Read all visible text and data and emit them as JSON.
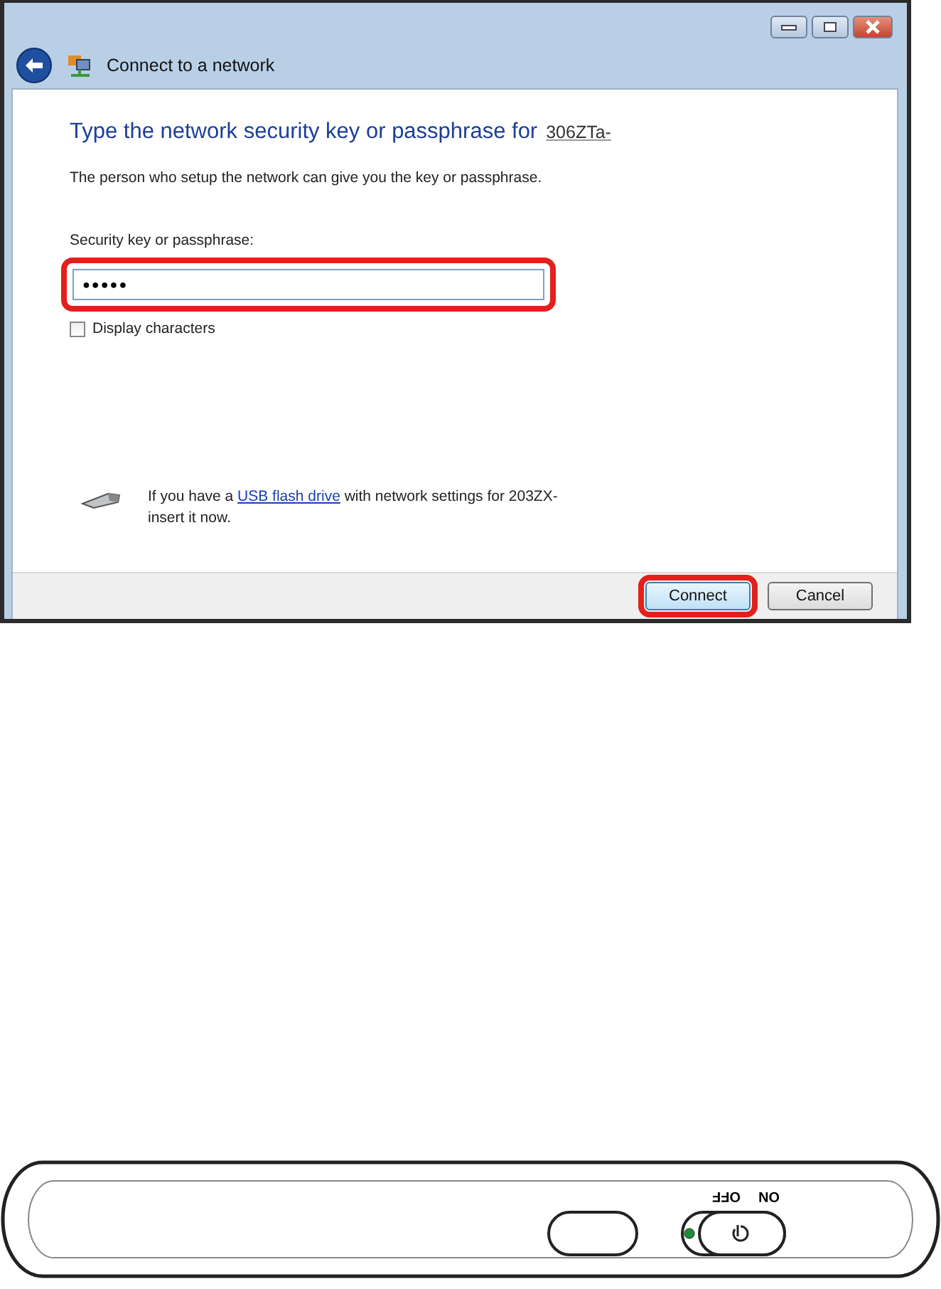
{
  "window": {
    "title": "Connect to a network"
  },
  "heading": {
    "text": "Type the network security key or passphrase for",
    "network_name": "306ZTa-"
  },
  "description": "The person who setup the network can give you the key or passphrase.",
  "key_field": {
    "label": "Security key or passphrase:",
    "value": "●●●●●",
    "annotated": true
  },
  "display_characters": {
    "label": "Display characters",
    "checked": false
  },
  "usb_note": {
    "before": "If you have a",
    "link": "USB flash drive",
    "after": "with network settings for 203ZX-",
    "line_2": "insert it now."
  },
  "buttons": [
    {
      "label": "Connect",
      "default": true,
      "annotated": true
    },
    {
      "label": "Cancel",
      "default": false,
      "annotated": false
    }
  ],
  "device": {
    "switch_labels": [
      "OFF",
      "ON"
    ],
    "led_on": true
  }
}
